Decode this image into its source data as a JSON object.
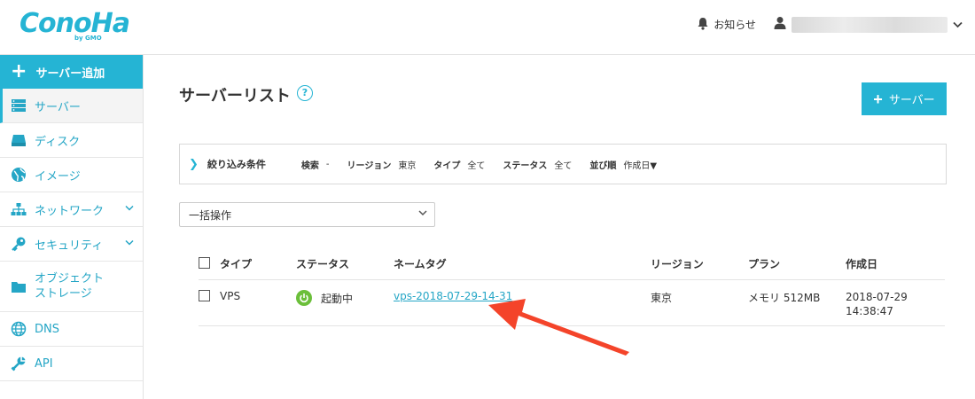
{
  "header": {
    "logo_text": "ConoHa",
    "logo_sub": "by GMO",
    "notice_label": "お知らせ",
    "user_name": ""
  },
  "sidebar": {
    "add_label": "サーバー追加",
    "items": [
      {
        "label": "サーバー",
        "icon": "server-icon",
        "active": true
      },
      {
        "label": "ディスク",
        "icon": "disk-icon"
      },
      {
        "label": "イメージ",
        "icon": "globe-image-icon"
      },
      {
        "label": "ネットワーク",
        "icon": "network-icon",
        "expandable": true
      },
      {
        "label": "セキュリティ",
        "icon": "key-icon",
        "expandable": true
      },
      {
        "label": "オブジェクト",
        "label2": "ストレージ",
        "icon": "folder-icon"
      },
      {
        "label": "DNS",
        "icon": "dns-globe-icon"
      },
      {
        "label": "API",
        "icon": "api-wrench-icon"
      }
    ]
  },
  "main": {
    "title": "サーバーリスト",
    "help": "?",
    "add_button": "サーバー",
    "filter": {
      "title": "絞り込み条件",
      "search_key": "検索",
      "search_val": "-",
      "region_key": "リージョン",
      "region_val": "東京",
      "type_key": "タイプ",
      "type_val": "全て",
      "status_key": "ステータス",
      "status_val": "全て",
      "sort_key": "並び順",
      "sort_val": "作成日▼"
    },
    "bulk_select": "一括操作",
    "table": {
      "headers": {
        "type": "タイプ",
        "status": "ステータス",
        "nametag": "ネームタグ",
        "region": "リージョン",
        "plan": "プラン",
        "created": "作成日"
      },
      "rows": [
        {
          "type": "VPS",
          "status": "起動中",
          "nametag": "vps-2018-07-29-14-31",
          "region": "東京",
          "plan": "メモリ 512MB",
          "created_date": "2018-07-29",
          "created_time": "14:38:47"
        }
      ]
    }
  },
  "colors": {
    "accent": "#25b4d4",
    "running": "#6bbf3a",
    "annotation_arrow": "#f4442a"
  }
}
